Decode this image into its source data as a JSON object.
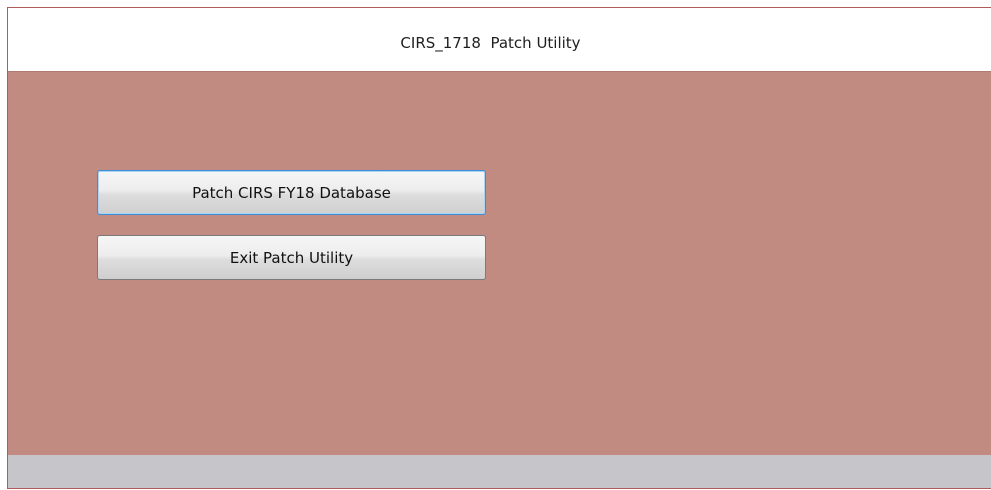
{
  "window": {
    "title": "CIRS_1718  Patch Utility"
  },
  "buttons": {
    "patch_label": "Patch CIRS FY18 Database",
    "exit_label": "Exit Patch Utility"
  },
  "colors": {
    "client_background": "#c18b82",
    "status_bar": "#c6c6ca",
    "focus_border": "#3c8fd6"
  }
}
